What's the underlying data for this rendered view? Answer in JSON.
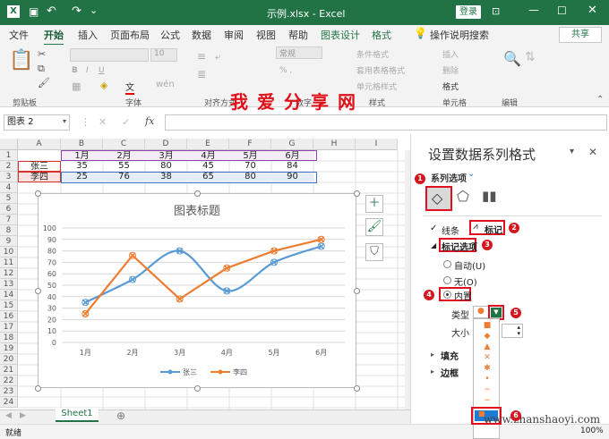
{
  "window": {
    "title": "示例.xlsx - Excel",
    "signin_label": "登录"
  },
  "tabs": [
    "文件",
    "开始",
    "插入",
    "页面布局",
    "公式",
    "数据",
    "审阅",
    "视图",
    "帮助",
    "图表设计",
    "格式"
  ],
  "active_tab": "开始",
  "tell_me": "操作说明搜索",
  "share_label": "共享",
  "ribbon": {
    "groups": [
      "剪贴板",
      "字体",
      "对齐方式",
      "数字",
      "样式",
      "单元格",
      "编辑"
    ],
    "font_size": "10",
    "number_format": "常规",
    "styles": [
      "条件格式",
      "套用表格格式",
      "单元格样式"
    ],
    "cells": [
      "插入",
      "删除",
      "格式"
    ],
    "font_label": "文"
  },
  "watermark": {
    "line1": "我爱分享网",
    "line2": "www.zhanshaoyi.com"
  },
  "name_box": "图表 2",
  "fx_label": "fx",
  "columns": [
    "A",
    "B",
    "C",
    "D",
    "E",
    "F",
    "G",
    "H",
    "I"
  ],
  "rows": [
    "1",
    "2",
    "3",
    "4",
    "5",
    "6",
    "7",
    "8",
    "9",
    "10",
    "11",
    "12",
    "13",
    "14",
    "15",
    "16",
    "17",
    "18",
    "19",
    "20",
    "21",
    "22",
    "23",
    "24"
  ],
  "table": {
    "header": [
      "",
      "1月",
      "2月",
      "3月",
      "4月",
      "5月",
      "6月"
    ],
    "rows": [
      [
        "张三",
        "35",
        "55",
        "80",
        "45",
        "70",
        "84"
      ],
      [
        "李四",
        "25",
        "76",
        "38",
        "65",
        "80",
        "90"
      ]
    ]
  },
  "chart_data": {
    "type": "line",
    "title": "图表标题",
    "categories": [
      "1月",
      "2月",
      "3月",
      "4月",
      "5月",
      "6月"
    ],
    "series": [
      {
        "name": "张三",
        "values": [
          35,
          55,
          80,
          45,
          70,
          84
        ],
        "color": "#5b9bd5"
      },
      {
        "name": "李四",
        "values": [
          25,
          76,
          38,
          65,
          80,
          90
        ],
        "color": "#ed7d31"
      }
    ],
    "ylim": [
      0,
      100
    ],
    "yticks": [
      0,
      10,
      20,
      30,
      40,
      50,
      60,
      70,
      80,
      90,
      100
    ],
    "grid": true,
    "legend": "bottom",
    "smooth": true,
    "marker": "x"
  },
  "sheet_tab": "Sheet1",
  "status": {
    "left": "就绪",
    "zoom": "100%"
  },
  "pane": {
    "title": "设置数据系列格式",
    "series_options": "系列选项",
    "line_tab": "线条",
    "marker_tab": "标记",
    "marker_options": "标记选项",
    "auto": "自动(U)",
    "none": "无(O)",
    "builtin": "内置",
    "type_label": "类型",
    "size_label": "大小",
    "fill_label": "填充",
    "border_label": "边框"
  },
  "badges": [
    "1",
    "2",
    "3",
    "4",
    "5",
    "6"
  ],
  "marker_types": [
    "■",
    "◆",
    "▲",
    "✕",
    "✱",
    "•",
    "−",
    "−",
    "▮",
    "+"
  ]
}
